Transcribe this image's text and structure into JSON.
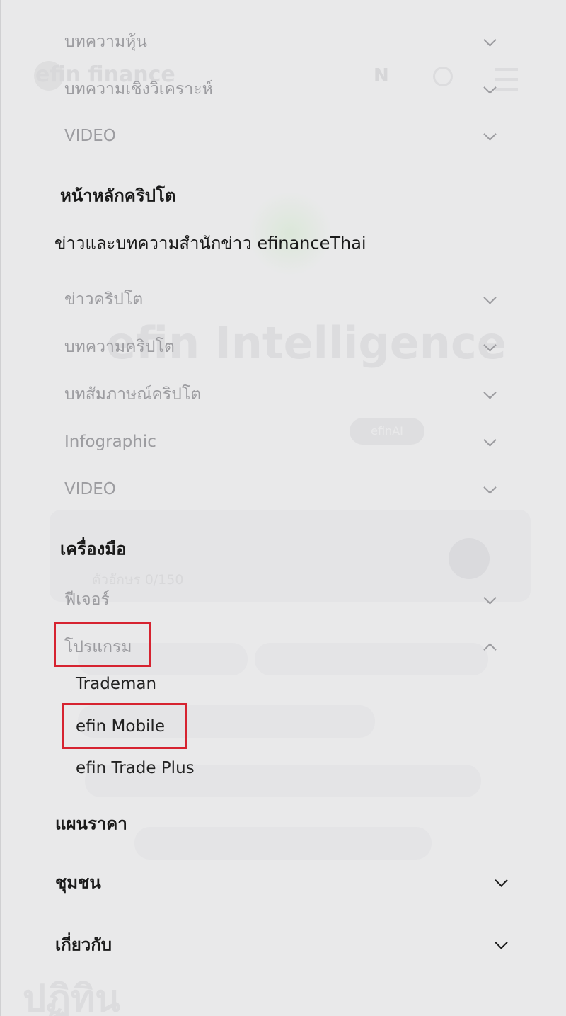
{
  "background": {
    "logo": "efin finance",
    "lang": "N",
    "hero": "efin Intelligence",
    "pill": "efinAI",
    "counter": "ตัวอักษร 0/150",
    "footer_heading": "ปฏิทิน"
  },
  "menu": {
    "items": [
      {
        "type": "sub",
        "label": "บทความหุ้น",
        "icon": "chevron-down-icon"
      },
      {
        "type": "sub",
        "label": "บทความเชิงวิเคราะห์",
        "icon": "chevron-down-icon"
      },
      {
        "type": "sub",
        "label": "VIDEO",
        "icon": "chevron-down-icon"
      },
      {
        "type": "head",
        "label": "หน้าหลักคริปโต"
      },
      {
        "type": "plain",
        "label": "ข่าวและบทความสำนักข่าว efinanceThai"
      },
      {
        "type": "sub",
        "label": "ข่าวคริปโต",
        "icon": "chevron-down-icon"
      },
      {
        "type": "sub",
        "label": "บทความคริปโต",
        "icon": "chevron-down-icon"
      },
      {
        "type": "sub",
        "label": "บทสัมภาษณ์คริปโต",
        "icon": "chevron-down-icon"
      },
      {
        "type": "sub",
        "label": "Infographic",
        "icon": "chevron-down-icon"
      },
      {
        "type": "sub",
        "label": "VIDEO",
        "icon": "chevron-down-icon"
      },
      {
        "type": "head",
        "label": "เครื่องมือ"
      },
      {
        "type": "sub",
        "label": "ฟีเจอร์",
        "icon": "chevron-down-icon"
      },
      {
        "type": "sub",
        "label": "โปรแกรม",
        "icon": "chevron-up-icon",
        "expanded": true,
        "highlighted": true
      },
      {
        "type": "child",
        "label": "Trademan"
      },
      {
        "type": "child",
        "label": "efin Mobile",
        "highlighted": true
      },
      {
        "type": "child",
        "label": "efin Trade Plus"
      },
      {
        "type": "top",
        "label": "แผนราคา"
      },
      {
        "type": "top",
        "label": "ชุมชน",
        "icon": "chevron-down-icon"
      },
      {
        "type": "top",
        "label": "เกี่ยวกับ",
        "icon": "chevron-down-icon"
      }
    ]
  },
  "colors": {
    "highlight_box": "#d62330",
    "overlay": "#e9e9ea",
    "sub_text": "#9c9ca0",
    "main_text": "#1a1a1a"
  }
}
